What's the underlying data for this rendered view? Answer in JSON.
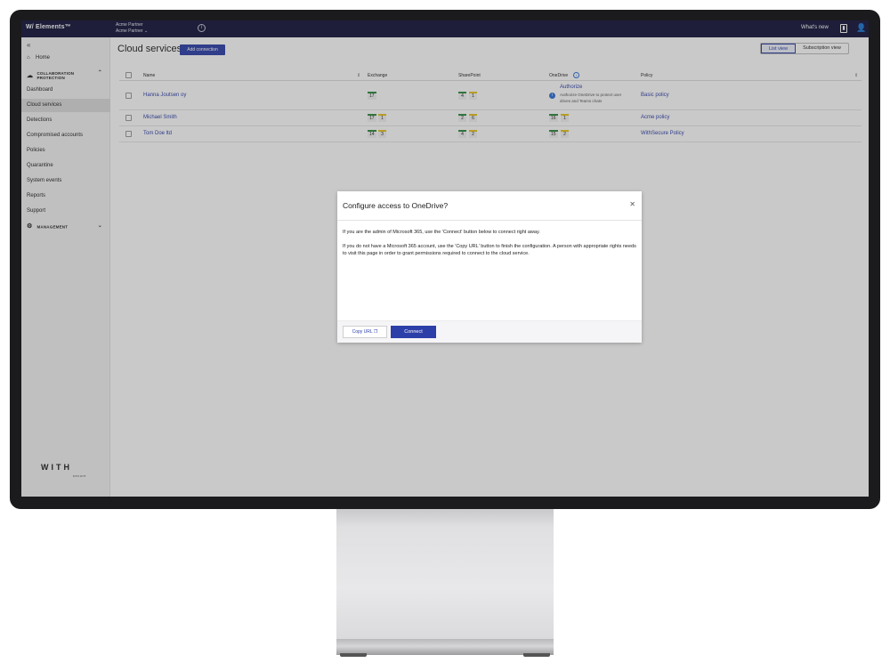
{
  "app": {
    "brand": "Elements™",
    "tenant_line1": "Acme Partner",
    "tenant_line2": "Acme Partner ⌄",
    "whats_new": "What's new"
  },
  "sidebar": {
    "home": "Home",
    "section_collab": "COLLABORATION PROTECTION",
    "items": [
      "Dashboard",
      "Cloud services",
      "Detections",
      "Compromised accounts",
      "Policies",
      "Quarantine",
      "System events",
      "Reports",
      "Support"
    ],
    "section_mgmt": "MANAGEMENT",
    "logo": "WITH",
    "logo_sub": "secure"
  },
  "main": {
    "title": "Cloud services",
    "add_button": "Add connection",
    "view_list": "List view",
    "view_subscription": "Subscription view"
  },
  "table": {
    "headers": {
      "name": "Name",
      "exchange": "Exchange",
      "sharepoint": "SharePoint",
      "onedrive": "OneDrive",
      "policy": "Policy"
    },
    "rows": [
      {
        "name": "Hanna Joutsen oy",
        "exchange": [
          "17"
        ],
        "sharepoint": [
          "4",
          "1"
        ],
        "onedrive_title": "Authorize",
        "onedrive_desc": "Authorize OneDrive to protect user drives and Teams chats",
        "policy": "Basic policy"
      },
      {
        "name": "Michael Smith",
        "exchange": [
          "17",
          "1"
        ],
        "sharepoint": [
          "2",
          "6"
        ],
        "onedrive": [
          "16",
          "1"
        ],
        "policy": "Acme policy"
      },
      {
        "name": "Tom Doe ltd",
        "exchange": [
          "14",
          "3"
        ],
        "sharepoint": [
          "4",
          "2"
        ],
        "onedrive": [
          "15",
          "2"
        ],
        "policy": "WithSecure Policy"
      }
    ]
  },
  "modal": {
    "title": "Configure access to OneDrive?",
    "p1": "If you are the admin of Microsoft 365, use the 'Connect' button below to connect right away.",
    "p2": "If you do not have a Microsoft 365 account, use the 'Copy URL' button to finish the configuration. A person with appropriate rights needs to visit this page in order to grant permissions required to connect to the cloud service.",
    "copy_button": "Copy URL",
    "connect_button": "Connect"
  },
  "colors": {
    "accent": "#2c3ea8",
    "topbar": "#12123a",
    "badge_green": "#2e8b3e",
    "badge_yellow": "#e8c21a"
  }
}
